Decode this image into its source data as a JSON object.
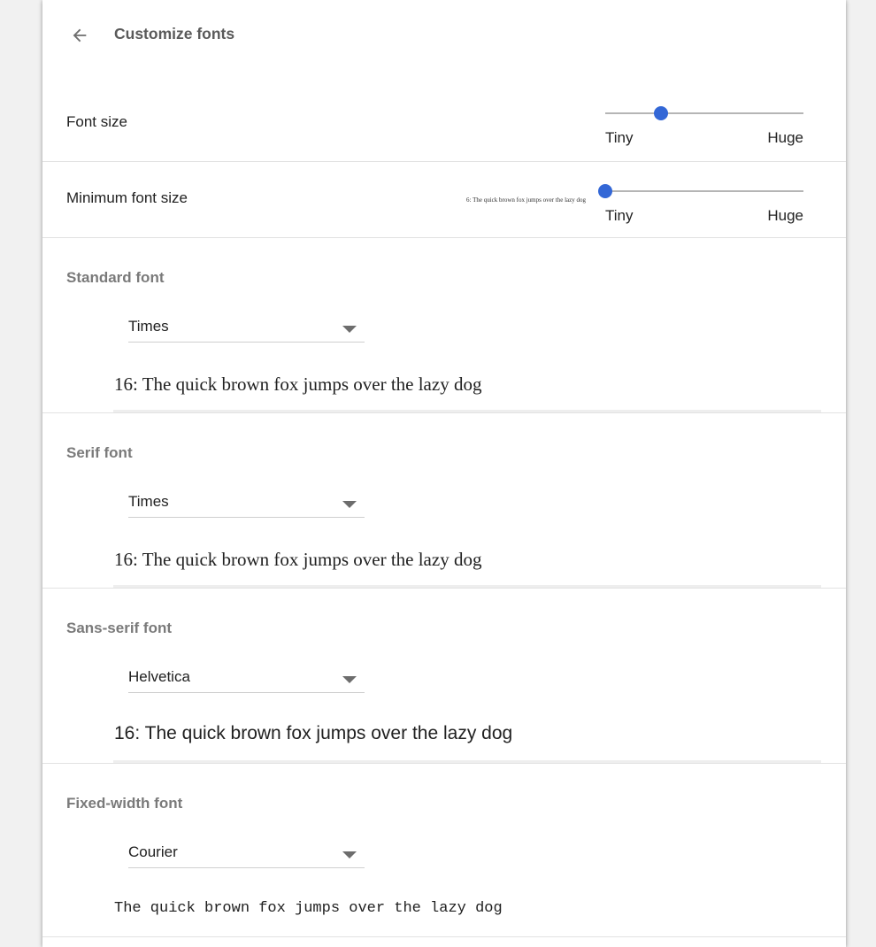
{
  "header": {
    "title": "Customize fonts",
    "back_icon": "arrow-back-icon"
  },
  "font_size": {
    "label": "Font size",
    "min_label": "Tiny",
    "max_label": "Huge",
    "level": 0.28
  },
  "minimum_font_size": {
    "label": "Minimum font size",
    "preview": "6: The quick brown fox jumps over the lazy dog",
    "min_label": "Tiny",
    "max_label": "Huge",
    "level": 0.0
  },
  "font_sections": [
    {
      "title": "Standard font",
      "selected": "Times",
      "preview": "16: The quick brown fox jumps over the lazy dog"
    },
    {
      "title": "Serif font",
      "selected": "Times",
      "preview": "16: The quick brown fox jumps over the lazy dog"
    },
    {
      "title": "Sans-serif font",
      "selected": "Helvetica",
      "preview": "16: The quick brown fox jumps over the lazy dog"
    },
    {
      "title": "Fixed-width font",
      "selected": "Courier",
      "preview": "The quick brown fox jumps over the lazy dog"
    }
  ],
  "colors": {
    "accent": "#3367d6",
    "background": "#f1f1f1",
    "card": "#ffffff"
  }
}
